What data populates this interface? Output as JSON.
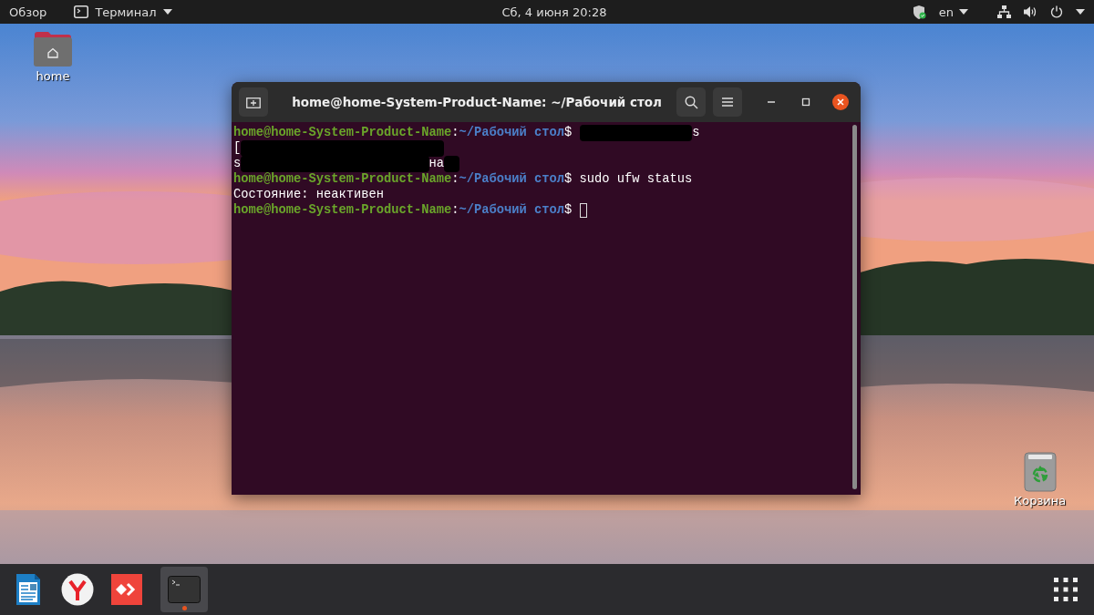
{
  "top_bar": {
    "activities": "Обзор",
    "app_menu": "Терминал",
    "clock": "Сб, 4 июня  20:28",
    "keyboard_layout": "en"
  },
  "desktop_icons": [
    {
      "kind": "folder",
      "label": "home"
    },
    {
      "kind": "trash",
      "label": "Корзина"
    }
  ],
  "terminal": {
    "title": "home@home-System-Product-Name: ~/Рабочий стол",
    "lines": [
      [
        {
          "kind": "user",
          "text": "home@home-System-Product-Name"
        },
        {
          "kind": "plain",
          "text": ":"
        },
        {
          "kind": "path",
          "text": "~/Рабочий стол"
        },
        {
          "kind": "plain",
          "text": "$ "
        },
        {
          "kind": "redaction"
        },
        {
          "kind": "plain",
          "text": "s"
        }
      ],
      [
        {
          "kind": "plain",
          "text": "["
        },
        {
          "kind": "redaction"
        }
      ],
      [
        {
          "kind": "plain",
          "text": "s"
        },
        {
          "kind": "redaction"
        },
        {
          "kind": "plain",
          "text": "на"
        },
        {
          "kind": "redaction"
        }
      ],
      [
        {
          "kind": "user",
          "text": "home@home-System-Product-Name"
        },
        {
          "kind": "plain",
          "text": ":"
        },
        {
          "kind": "path",
          "text": "~/Рабочий стол"
        },
        {
          "kind": "plain",
          "text": "$ sudo ufw status"
        }
      ],
      [
        {
          "kind": "plain",
          "text": "Состояние: неактивен"
        }
      ],
      [
        {
          "kind": "user",
          "text": "home@home-System-Product-Name"
        },
        {
          "kind": "plain",
          "text": ":"
        },
        {
          "kind": "path",
          "text": "~/Рабочий стол"
        },
        {
          "kind": "plain",
          "text": "$ "
        },
        {
          "kind": "cursor"
        }
      ]
    ]
  },
  "dock": [
    {
      "kind": "writer",
      "running": false
    },
    {
      "kind": "browser",
      "running": false
    },
    {
      "kind": "remote",
      "running": false
    },
    {
      "kind": "terminal",
      "running": true
    }
  ]
}
